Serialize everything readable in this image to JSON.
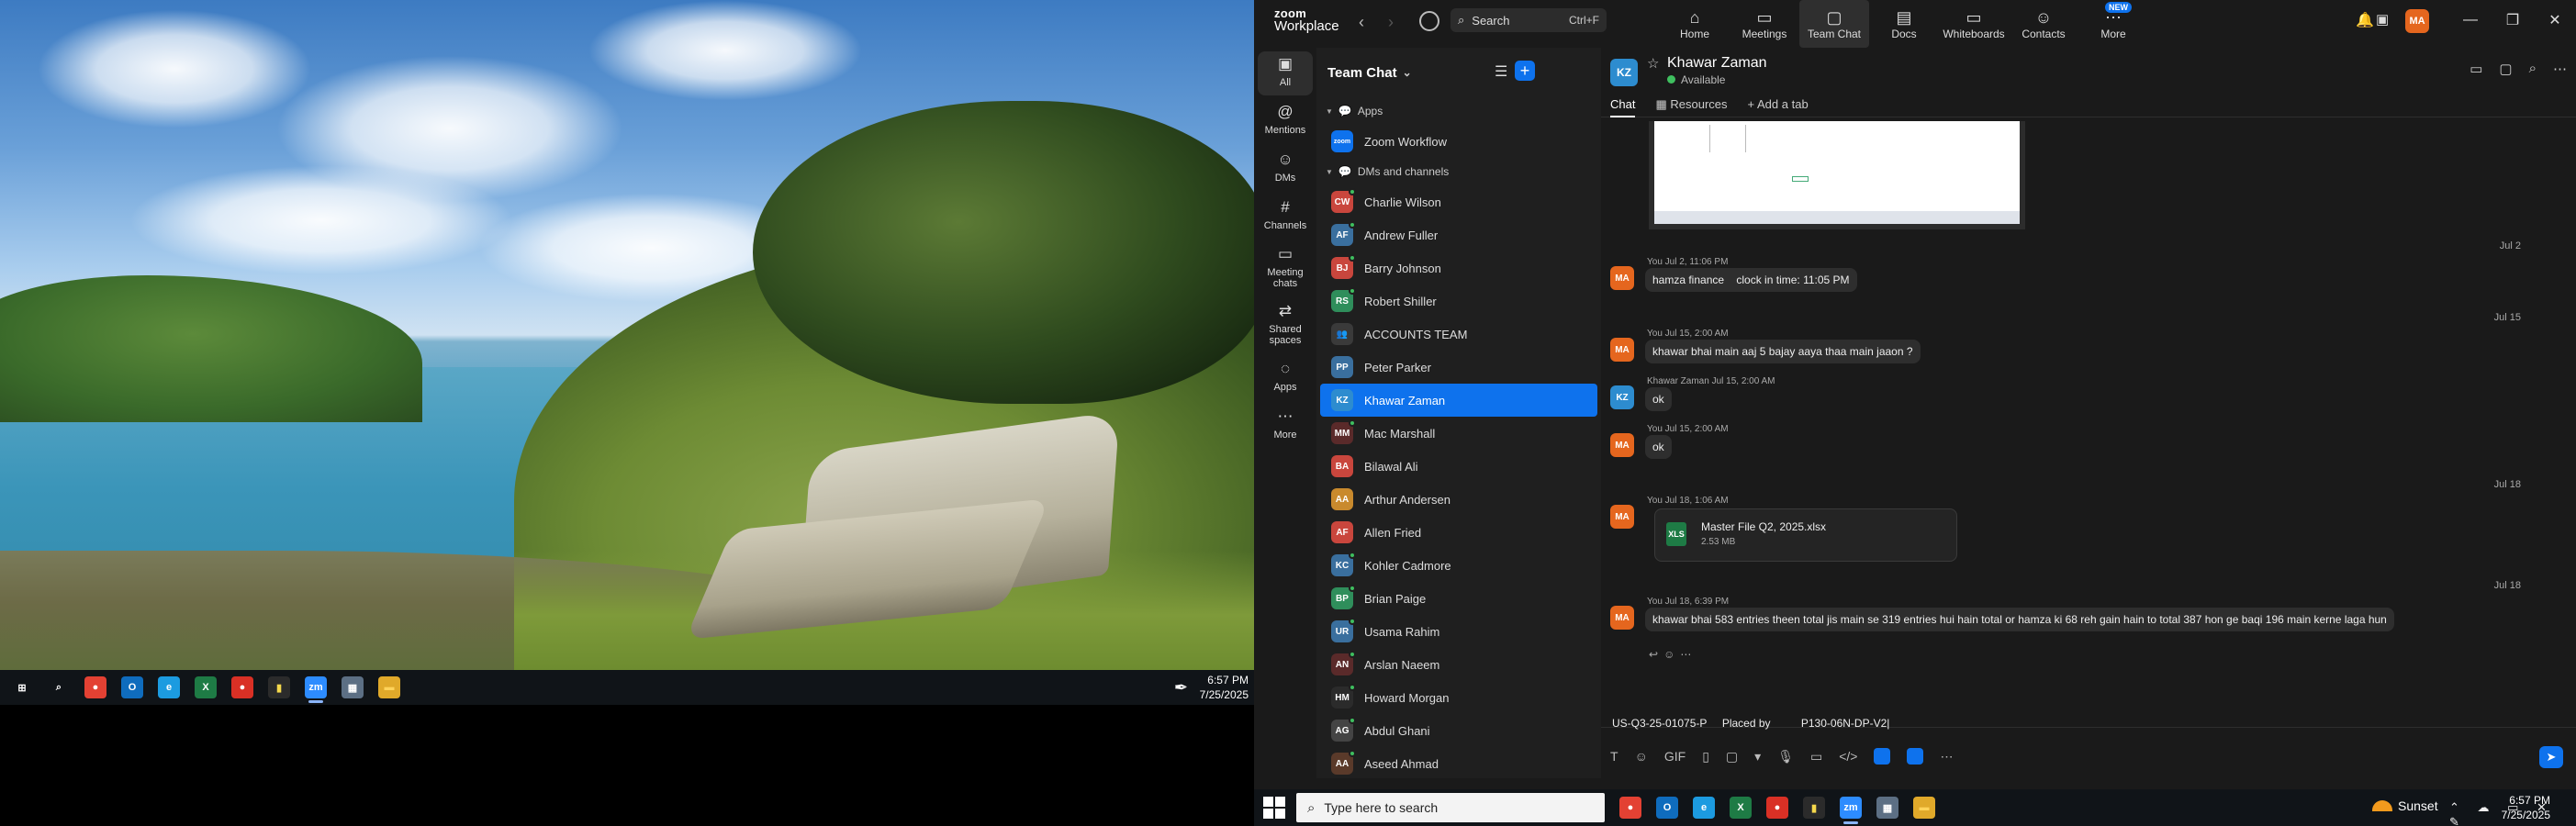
{
  "left_monitor": {
    "taskbar": {
      "apps": [
        {
          "name": "windows-start-icon",
          "glyph": "⊞",
          "color": "#ffffff",
          "bg": "transparent"
        },
        {
          "name": "search-icon",
          "glyph": "⌕",
          "color": "#ffffff",
          "bg": "transparent"
        },
        {
          "name": "chrome-icon",
          "glyph": "●",
          "color": "#ffffff",
          "bg": "#e34133"
        },
        {
          "name": "outlook-icon",
          "glyph": "O",
          "color": "#ffffff",
          "bg": "#0f6cbd"
        },
        {
          "name": "edge-icon",
          "glyph": "e",
          "color": "#ffffff",
          "bg": "#1c9be0"
        },
        {
          "name": "excel-icon",
          "glyph": "X",
          "color": "#ffffff",
          "bg": "#1e7b45"
        },
        {
          "name": "chrome-profile-icon",
          "glyph": "●",
          "color": "#ffffff",
          "bg": "#d93025"
        },
        {
          "name": "sticky-notes-icon",
          "glyph": "▮",
          "color": "#f6d94c",
          "bg": "#2b2b2b"
        },
        {
          "name": "zoom-icon",
          "glyph": "zm",
          "color": "#ffffff",
          "bg": "#2d8cff"
        },
        {
          "name": "calculator-icon",
          "glyph": "▦",
          "color": "#ffffff",
          "bg": "#5c6f84"
        },
        {
          "name": "file-explorer-icon",
          "glyph": "▬",
          "color": "#ffd35a",
          "bg": "#e0a92a"
        }
      ],
      "active_app_index": 8,
      "time": "6:57 PM",
      "date": "7/25/2025"
    }
  },
  "zoom": {
    "logo_line1": "zoom",
    "logo_line2": "Workplace",
    "search_label": "Search",
    "search_shortcut": "Ctrl+F",
    "nav": [
      {
        "label": "Home",
        "icon": "⌂"
      },
      {
        "label": "Meetings",
        "icon": "▭"
      },
      {
        "label": "Team Chat",
        "icon": "▢"
      },
      {
        "label": "Docs",
        "icon": "▤"
      },
      {
        "label": "Whiteboards",
        "icon": "▭"
      },
      {
        "label": "Contacts",
        "icon": "☺"
      },
      {
        "label": "More",
        "icon": "⋯"
      }
    ],
    "nav_selected": "Team Chat",
    "new_badge": "NEW",
    "user_avatar": "MA",
    "rail": [
      {
        "label": "All",
        "icon": "▣"
      },
      {
        "label": "Mentions",
        "icon": "@"
      },
      {
        "label": "DMs",
        "icon": "☺"
      },
      {
        "label": "Channels",
        "icon": "#"
      },
      {
        "label": "Meeting chats",
        "icon": "▭"
      },
      {
        "label": "Shared spaces",
        "icon": "⇄"
      },
      {
        "label": "Apps",
        "icon": "◌"
      },
      {
        "label": "More",
        "icon": "⋯"
      }
    ],
    "list_title": "Team Chat",
    "sections": {
      "apps": "Apps",
      "dms": "DMs and channels"
    },
    "app_item": {
      "label": "Zoom Workflow",
      "initials": "zoom",
      "color": "#0e72ed"
    },
    "contacts": [
      {
        "initials": "CW",
        "name": "Charlie Wilson",
        "color": "#c9463d",
        "online": true
      },
      {
        "initials": "AF",
        "name": "Andrew Fuller",
        "color": "#3a6f9e",
        "online": true
      },
      {
        "initials": "BJ",
        "name": "Barry Johnson",
        "color": "#c9463d",
        "online": true
      },
      {
        "initials": "RS",
        "name": "Robert Shiller",
        "color": "#2f8e5b",
        "online": true
      },
      {
        "initials": "👥",
        "name": "ACCOUNTS TEAM",
        "color": "#3a3a3a",
        "online": false
      },
      {
        "initials": "PP",
        "name": "Peter Parker",
        "color": "#3a6f9e",
        "online": false
      },
      {
        "initials": "KZ",
        "name": "Khawar Zaman",
        "color": "#2d8ccf",
        "online": false
      },
      {
        "initials": "MM",
        "name": "Mac Marshall",
        "color": "#5a2a2a",
        "online": true
      },
      {
        "initials": "BA",
        "name": "Bilawal Ali",
        "color": "#c9463d",
        "online": false
      },
      {
        "initials": "AA",
        "name": "Arthur Andersen",
        "color": "#c98a2d",
        "online": false
      },
      {
        "initials": "AF",
        "name": "Allen Fried",
        "color": "#c9463d",
        "online": false
      },
      {
        "initials": "KC",
        "name": "Kohler Cadmore",
        "color": "#3a6f9e",
        "online": true
      },
      {
        "initials": "BP",
        "name": "Brian Paige",
        "color": "#2f8e5b",
        "online": true
      },
      {
        "initials": "UR",
        "name": "Usama Rahim",
        "color": "#3a6f9e",
        "online": true
      },
      {
        "initials": "AN",
        "name": "Arslan Naeem",
        "color": "#5a2a2a",
        "online": true
      },
      {
        "initials": "HM",
        "name": "Howard Morgan",
        "color": "#2b2b2b",
        "online": true
      },
      {
        "initials": "AG",
        "name": "Abdul Ghani",
        "color": "#444",
        "online": true
      },
      {
        "initials": "AA",
        "name": "Aseed Ahmad",
        "color": "#5a3a2a",
        "online": true
      }
    ],
    "selected_contact": "Khawar Zaman",
    "chat": {
      "avatar": "KZ",
      "name": "Khawar Zaman",
      "status": "Available",
      "tabs": [
        "Chat",
        "Resources",
        "Add a tab"
      ],
      "date_seps": [
        "Jul 2",
        "Jul 15",
        "Jul 18",
        "Jul 18"
      ],
      "messages": [
        {
          "avatar": "MA",
          "meta": "You Jul 2, 11:06 PM",
          "text": "hamza finance    clock in time: 11:05 PM"
        },
        {
          "avatar": "MA",
          "meta": "You Jul 15, 2:00 AM",
          "text": "khawar bhai main aaj 5 bajay aaya thaa main jaaon ?"
        },
        {
          "avatar": "KZ",
          "meta": "Khawar Zaman Jul 15, 2:00 AM",
          "text": "ok"
        },
        {
          "avatar": "MA",
          "meta": "You Jul 15, 2:00 AM",
          "text": "ok"
        },
        {
          "avatar": "MA",
          "meta": "You Jul 18, 1:06 AM",
          "text": ""
        },
        {
          "avatar": "MA",
          "meta": "You Jul 18, 6:39 PM",
          "text": "khawar bhai 583 entries theen total jis main se 319 entries hui hain total or hamza ki 68 reh gain hain to total 387 hon ge baqi 196 main kerne laga hun"
        }
      ],
      "file": {
        "name": "Master File Q2, 2025.xlsx",
        "size": "2.53 MB",
        "icon": "XLS"
      },
      "draft": "US-Q3-25-01075-P     Placed by          P130-06N-DP-V2|",
      "compose_tools": [
        "T",
        "☺",
        "GIF",
        "▯",
        "▢",
        "▾",
        "🎙",
        "▭",
        "</>"
      ]
    }
  },
  "right_taskbar": {
    "search_placeholder": "Type here to search",
    "apps": [
      {
        "name": "chrome-icon",
        "glyph": "●",
        "color": "#ffffff",
        "bg": "#e34133"
      },
      {
        "name": "outlook-icon",
        "glyph": "O",
        "color": "#ffffff",
        "bg": "#0f6cbd"
      },
      {
        "name": "edge-icon",
        "glyph": "e",
        "color": "#ffffff",
        "bg": "#1c9be0"
      },
      {
        "name": "excel-icon",
        "glyph": "X",
        "color": "#ffffff",
        "bg": "#1e7b45"
      },
      {
        "name": "chrome-profile-icon",
        "glyph": "●",
        "color": "#ffffff",
        "bg": "#d93025"
      },
      {
        "name": "sticky-notes-icon",
        "glyph": "▮",
        "color": "#f6d94c",
        "bg": "#2b2b2b"
      },
      {
        "name": "zoom-icon",
        "glyph": "zm",
        "color": "#ffffff",
        "bg": "#2d8cff"
      },
      {
        "name": "calculator-icon",
        "glyph": "▦",
        "color": "#ffffff",
        "bg": "#5c6f84"
      },
      {
        "name": "file-explorer-icon",
        "glyph": "▬",
        "color": "#ffd35a",
        "bg": "#e0a92a"
      }
    ],
    "active_app_index": 6,
    "weather": "Sunset",
    "tray": "⌃ ☁ ▭ ✕ ✎",
    "time": "6:57 PM",
    "date": "7/25/2025"
  }
}
